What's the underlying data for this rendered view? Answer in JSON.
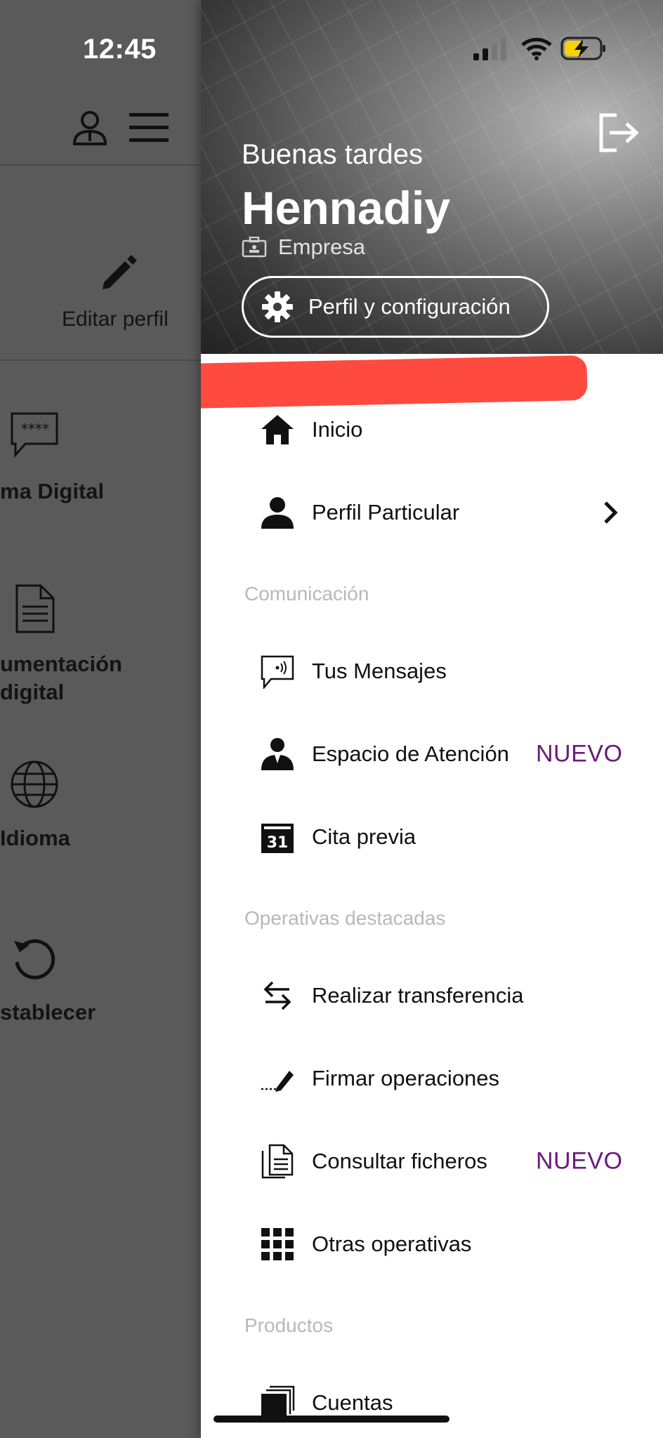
{
  "status_bar": {
    "time": "12:45"
  },
  "background_app": {
    "edit_profile": "Editar perfil",
    "items": [
      {
        "label": "ma Digital"
      },
      {
        "label_line1": "umentación",
        "label_line2": "digital"
      },
      {
        "label": "Idioma"
      },
      {
        "label": "stablecer"
      }
    ]
  },
  "drawer": {
    "greeting": "Buenas tardes",
    "user_name": "Hennadiy",
    "company": "Empresa",
    "profile_button": "Perfil y configuración",
    "menu": {
      "inicio": "Inicio",
      "perfil_particular": "Perfil Particular"
    },
    "sections": {
      "comunicacion": "Comunicación",
      "operativas": "Operativas destacadas",
      "productos": "Productos"
    },
    "comunicacion_items": {
      "mensajes": "Tus Mensajes",
      "atencion": "Espacio de Atención",
      "cita": "Cita previa"
    },
    "operativas_items": {
      "transferencia": "Realizar transferencia",
      "firmar": "Firmar operaciones",
      "ficheros": "Consultar ficheros",
      "otras": "Otras operativas"
    },
    "productos_items": {
      "cuentas": "Cuentas"
    },
    "badge_new": "NUEVO",
    "calendar_day": "31"
  },
  "colors": {
    "accent_badge": "#6b1a7a",
    "battery": "#f7d300",
    "redaction": "#ff3b30"
  }
}
